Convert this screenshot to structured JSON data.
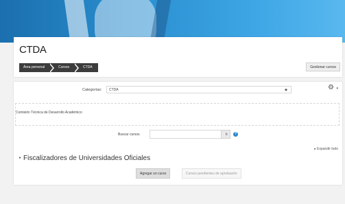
{
  "header": {
    "title": "CTDA",
    "breadcrumb": [
      "Área personal",
      "Cursos",
      "CTDA"
    ],
    "manage_button": "Gestionar cursos"
  },
  "filters": {
    "category_label": "Categorías:",
    "category_value": "CTDA"
  },
  "description": "Comisión Técnica de Desarrollo Académico",
  "search": {
    "label": "Buscar cursos",
    "go_label": "Ir"
  },
  "expand_all": "Expandir todo",
  "category_heading": "Fiscalizadores de Universidades Oficiales",
  "buttons": {
    "add_course": "Agregar un curso",
    "pending_courses": "Cursos pendientes de aprobación"
  },
  "colors": {
    "banner": "#2a8fd0",
    "breadcrumb_bg": "#3c3c3c",
    "help_icon": "#2d88c9"
  }
}
